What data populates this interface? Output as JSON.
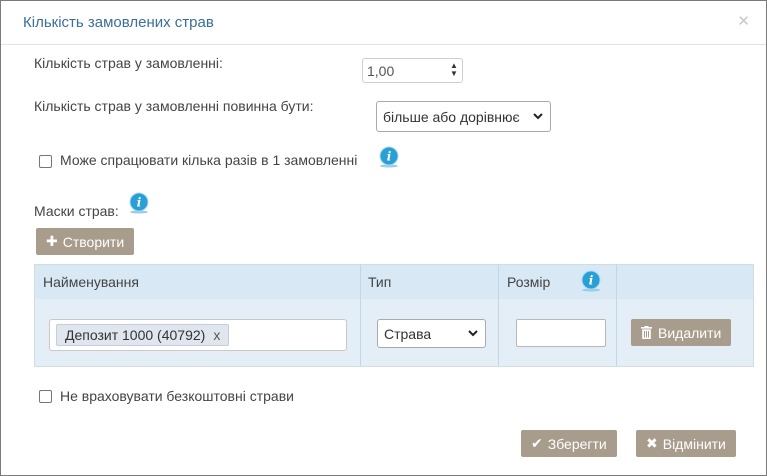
{
  "dialog": {
    "title": "Кількість замовлених страв",
    "close_icon": "close-icon"
  },
  "form": {
    "quantity_label": "Кількість страв у замовленні:",
    "quantity_value": "1,00",
    "condition_label": "Кількість страв у замовленні повинна бути:",
    "condition_selected": "більше або дорівнює",
    "multiple_label": "Може спрацювати кілька разів в 1 замовленні",
    "multiple_checked": false,
    "masks_label": "Маски страв:"
  },
  "create_button": {
    "label": "Створити",
    "icon": "plus-icon"
  },
  "table": {
    "columns": [
      "Найменування",
      "Тип",
      "Розмір"
    ],
    "rows": [
      {
        "tag": "Депозит 1000 (40792)",
        "tag_remove": "x",
        "type": "Страва",
        "size": "",
        "delete_label": "Видалити"
      }
    ]
  },
  "ignore_free": {
    "label": "Не враховувати безкоштовні страви",
    "checked": false
  },
  "footer": {
    "save_label": "Зберегти",
    "cancel_label": "Відмінити"
  },
  "colors": {
    "title": "#3a6f9a",
    "button": "#a89c8c",
    "table_header": "#d8e8f4",
    "table_row": "#e3eef7",
    "info_icon": "#2a9fd6"
  }
}
